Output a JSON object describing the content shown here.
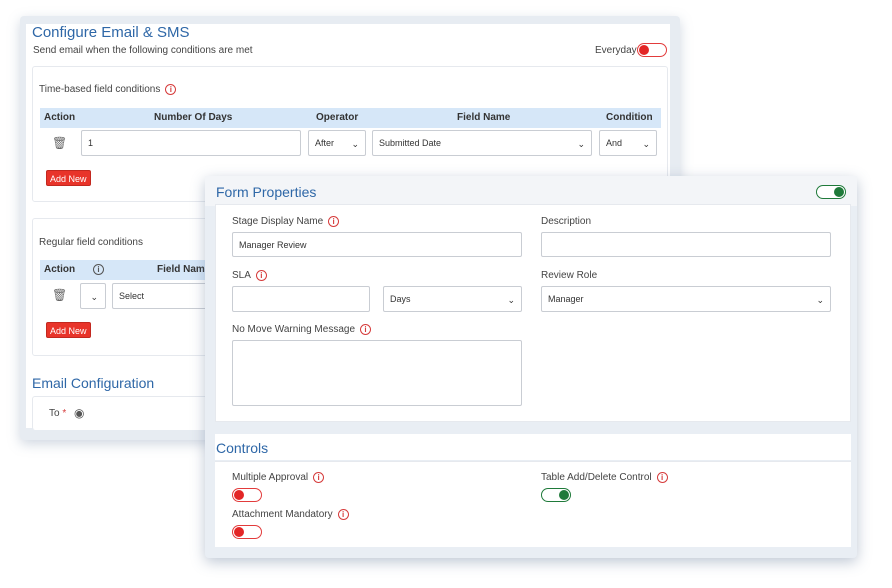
{
  "email_sms": {
    "title": "Configure Email & SMS",
    "subtitle": "Send email when the following conditions are met",
    "everyday_label": "Everyday",
    "time_based": {
      "heading": "Time-based field conditions",
      "columns": [
        "Action",
        "Number Of Days",
        "Operator",
        "Field Name",
        "Condition"
      ],
      "row": {
        "days": "1",
        "operator": "After",
        "field_name": "Submitted Date",
        "condition": "And"
      },
      "add_new": "Add New"
    },
    "regular": {
      "heading": "Regular field conditions",
      "columns": [
        "Action",
        "Field Name"
      ],
      "row": {
        "select": "Select"
      },
      "add_new": "Add New"
    },
    "email_config": {
      "title": "Email Configuration",
      "to_label": "To",
      "required_mark": "*"
    }
  },
  "form_properties": {
    "title": "Form Properties",
    "stage_display_name_label": "Stage Display Name",
    "stage_display_name_value": "Manager Review",
    "description_label": "Description",
    "description_value": "",
    "sla_label": "SLA",
    "sla_value": "",
    "sla_unit": "Days",
    "review_role_label": "Review Role",
    "review_role_value": "Manager",
    "no_move_label": "No Move Warning Message",
    "no_move_value": ""
  },
  "controls": {
    "title": "Controls",
    "multiple_approval_label": "Multiple Approval",
    "multiple_approval_on": false,
    "table_add_delete_label": "Table Add/Delete Control",
    "table_add_delete_on": true,
    "attachment_mandatory_label": "Attachment Mandatory",
    "attachment_mandatory_on": false
  },
  "colors": {
    "accent_blue": "#2e67a7",
    "table_header": "#d6e7f8",
    "toggle_off": "#e32626",
    "toggle_on": "#1f7a3a",
    "button_red": "#e8342a"
  }
}
